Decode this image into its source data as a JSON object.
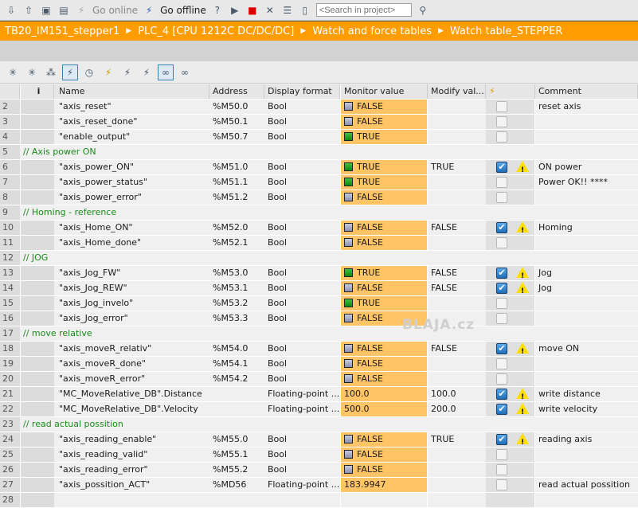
{
  "toolbar": {
    "go_online": "Go online",
    "go_offline": "Go offline",
    "search_placeholder": "<Search in project>"
  },
  "breadcrumb": [
    "TB20_IM151_stepper1",
    "PLC_4 [CPU 1212C DC/DC/DC]",
    "Watch and force tables",
    "Watch table_STEPPER"
  ],
  "columns": {
    "info": "i",
    "name": "Name",
    "address": "Address",
    "display_format": "Display format",
    "monitor_value": "Monitor value",
    "modify_value": "Modify val...",
    "comment": "Comment"
  },
  "watermark": "BLAJA.cz",
  "rows": [
    {
      "n": "2",
      "name": "\"axis_reset\"",
      "addr": "%M50.0",
      "fmt": "Bool",
      "mon": "FALSE",
      "mod": "",
      "chk": false,
      "comment": "reset axis"
    },
    {
      "n": "3",
      "name": "\"axis_reset_done\"",
      "addr": "%M50.1",
      "fmt": "Bool",
      "mon": "FALSE",
      "mod": "",
      "chk": false,
      "comment": ""
    },
    {
      "n": "4",
      "name": "\"enable_output\"",
      "addr": "%M50.7",
      "fmt": "Bool",
      "mon": "TRUE",
      "mod": "",
      "chk": false,
      "comment": ""
    },
    {
      "n": "5",
      "group": "// Axis power ON"
    },
    {
      "n": "6",
      "name": "\"axis_power_ON\"",
      "addr": "%M51.0",
      "fmt": "Bool",
      "mon": "TRUE",
      "mod": "TRUE",
      "chk": true,
      "comment": "ON power"
    },
    {
      "n": "7",
      "name": "\"axis_power_status\"",
      "addr": "%M51.1",
      "fmt": "Bool",
      "mon": "TRUE",
      "mod": "",
      "chk": false,
      "comment": "Power OK!! ****"
    },
    {
      "n": "8",
      "name": "\"axis_power_error\"",
      "addr": "%M51.2",
      "fmt": "Bool",
      "mon": "FALSE",
      "mod": "",
      "chk": false,
      "comment": ""
    },
    {
      "n": "9",
      "group": "// Homing - reference"
    },
    {
      "n": "10",
      "name": "\"axis_Home_ON\"",
      "addr": "%M52.0",
      "fmt": "Bool",
      "mon": "FALSE",
      "mod": "FALSE",
      "chk": true,
      "comment": "Homing"
    },
    {
      "n": "11",
      "name": "\"axis_Home_done\"",
      "addr": "%M52.1",
      "fmt": "Bool",
      "mon": "FALSE",
      "mod": "",
      "chk": false,
      "comment": ""
    },
    {
      "n": "12",
      "group": "// JOG"
    },
    {
      "n": "13",
      "name": "\"axis_Jog_FW\"",
      "addr": "%M53.0",
      "fmt": "Bool",
      "mon": "TRUE",
      "mod": "FALSE",
      "chk": true,
      "comment": "Jog"
    },
    {
      "n": "14",
      "name": "\"axis_Jog_REW\"",
      "addr": "%M53.1",
      "fmt": "Bool",
      "mon": "FALSE",
      "mod": "FALSE",
      "chk": true,
      "comment": "Jog"
    },
    {
      "n": "15",
      "name": "\"axis_Jog_invelo\"",
      "addr": "%M53.2",
      "fmt": "Bool",
      "mon": "TRUE",
      "mod": "",
      "chk": false,
      "comment": ""
    },
    {
      "n": "16",
      "name": "\"axis_Jog_error\"",
      "addr": "%M53.3",
      "fmt": "Bool",
      "mon": "FALSE",
      "mod": "",
      "chk": false,
      "comment": ""
    },
    {
      "n": "17",
      "group": "// move relative"
    },
    {
      "n": "18",
      "name": "\"axis_moveR_relativ\"",
      "addr": "%M54.0",
      "fmt": "Bool",
      "mon": "FALSE",
      "mod": "FALSE",
      "chk": true,
      "comment": "move ON"
    },
    {
      "n": "19",
      "name": "\"axis_moveR_done\"",
      "addr": "%M54.1",
      "fmt": "Bool",
      "mon": "FALSE",
      "mod": "",
      "chk": false,
      "comment": ""
    },
    {
      "n": "20",
      "name": "\"axis_moveR_error\"",
      "addr": "%M54.2",
      "fmt": "Bool",
      "mon": "FALSE",
      "mod": "",
      "chk": false,
      "comment": ""
    },
    {
      "n": "21",
      "name": "\"MC_MoveRelative_DB\".Distance",
      "addr": "",
      "fmt": "Floating-point ...",
      "mon": "100.0",
      "mod": "100.0",
      "chk": true,
      "comment": "write distance"
    },
    {
      "n": "22",
      "name": "\"MC_MoveRelative_DB\".Velocity",
      "addr": "",
      "fmt": "Floating-point ...",
      "mon": "500.0",
      "mod": "200.0",
      "chk": true,
      "comment": "write velocity"
    },
    {
      "n": "23",
      "group": "// read actual possition"
    },
    {
      "n": "24",
      "name": "\"axis_reading_enable\"",
      "addr": "%M55.0",
      "fmt": "Bool",
      "mon": "FALSE",
      "mod": "TRUE",
      "chk": true,
      "comment": "reading axis"
    },
    {
      "n": "25",
      "name": "\"axis_reading_valid\"",
      "addr": "%M55.1",
      "fmt": "Bool",
      "mon": "FALSE",
      "mod": "",
      "chk": false,
      "comment": ""
    },
    {
      "n": "26",
      "name": "\"axis_reading_error\"",
      "addr": "%M55.2",
      "fmt": "Bool",
      "mon": "FALSE",
      "mod": "",
      "chk": false,
      "comment": ""
    },
    {
      "n": "27",
      "name": "\"axis_possition_ACT\"",
      "addr": "%MD56",
      "fmt": "Floating-point ...",
      "mon": "183.9947",
      "mod": "",
      "chk": false,
      "comment": "read actual possition"
    },
    {
      "n": "28",
      "name": "",
      "addr": "",
      "fmt": "",
      "mon": "",
      "mod": "",
      "chk": false,
      "comment": "",
      "empty": true
    }
  ]
}
